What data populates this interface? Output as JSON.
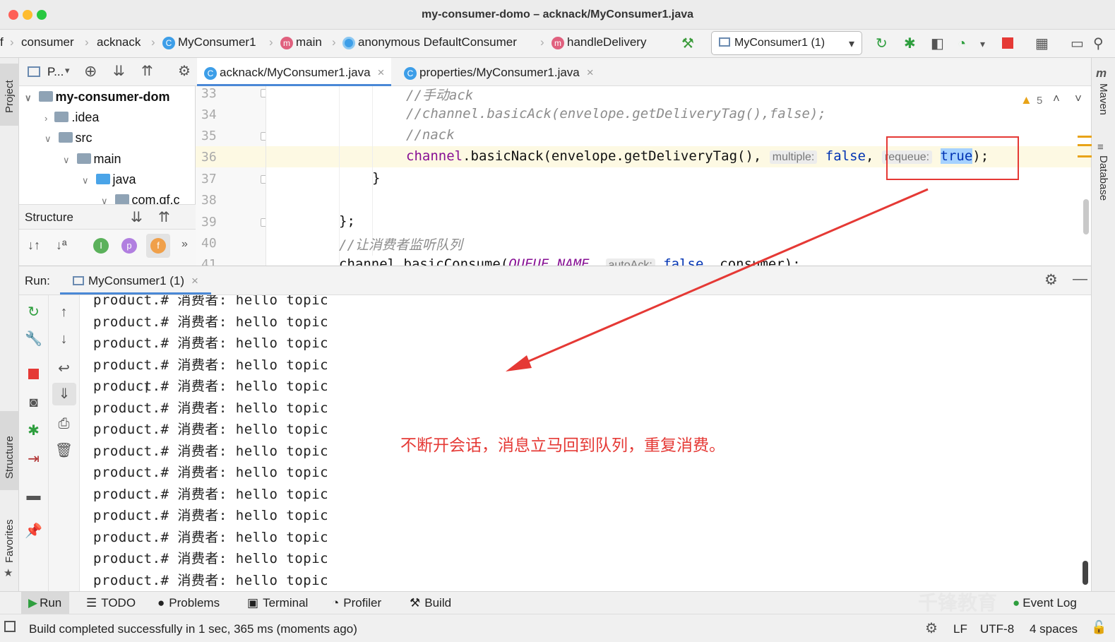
{
  "window": {
    "title": "my-consumer-domo – acknack/MyConsumer1.java"
  },
  "breadcrumb": {
    "lead": "f",
    "items": [
      "consumer",
      "acknack",
      "MyConsumer1",
      "main",
      "anonymous DefaultConsumer",
      "handleDelivery"
    ],
    "icons": [
      "",
      "",
      "C",
      "m",
      "",
      "m"
    ]
  },
  "toolbar": {
    "run_config": "MyConsumer1 (1)"
  },
  "project_panel": {
    "title": "P...",
    "tree": [
      {
        "label": "my-consumer-dom",
        "bold": true
      },
      {
        "label": ".idea"
      },
      {
        "label": "src"
      },
      {
        "label": "main"
      },
      {
        "label": "java"
      },
      {
        "label": "com.qf.c"
      }
    ]
  },
  "structure_panel": {
    "title": "Structure",
    "icon_letters": [
      "I",
      "p",
      "f"
    ],
    "more": "»"
  },
  "editor": {
    "tabs": [
      "acknack/MyConsumer1.java",
      "properties/MyConsumer1.java"
    ],
    "tab_icons": [
      "C",
      "C"
    ],
    "line_numbers": [
      "33",
      "34",
      "35",
      "36",
      "37",
      "38",
      "39",
      "40",
      "41"
    ],
    "lines": {
      "l33": "//手动ack",
      "l34": "//channel.basicAck(envelope.getDeliveryTag(),false);",
      "l35": "//nack",
      "l36_obj": "channel",
      "l36_call": ".basicNack(envelope.getDeliveryTag(), ",
      "l36_hint1": "multiple:",
      "l36_false": "false",
      "l36_comma": ", ",
      "l36_hint2": "requeue:",
      "l36_true": "true",
      "l36_end": ");",
      "l37": "}",
      "l39": "};",
      "l40": "//让消费者监听队列",
      "l41_a": "channel.basicConsume(",
      "l41_b": "QUEUE_NAME",
      "l41_c": ", ",
      "l41_hint": "autoAck:",
      "l41_false": "false",
      "l41_d": ", consumer);"
    },
    "warning_count": "5"
  },
  "run": {
    "label": "Run:",
    "tab": "MyConsumer1 (1)",
    "output": [
      "product.# 消费者: hello topic",
      "product.# 消费者: hello topic",
      "product.# 消费者: hello topic",
      "product.# 消费者: hello topic",
      "product.# 消费者: hello topic",
      "product.# 消费者: hello topic",
      "product.# 消费者: hello topic",
      "product.# 消费者: hello topic",
      "product.# 消费者: hello topic",
      "product.# 消费者: hello topic",
      "product.# 消费者: hello topic",
      "product.# 消费者: hello topic",
      "product.# 消费者: hello topic",
      "product.# 消费者: hello topic"
    ]
  },
  "annotation": {
    "text": "不断开会话，消息立马回到队列，重复消费。",
    "color": "#e53935"
  },
  "side_labels": {
    "project": "Project",
    "structure": "Structure",
    "favorites": "Favorites",
    "maven": "Maven",
    "database": "Database"
  },
  "bottom_tabs": [
    "Run",
    "TODO",
    "Problems",
    "Terminal",
    "Profiler",
    "Build"
  ],
  "event_log": "Event Log",
  "watermark": "千锋教育",
  "status": {
    "message": "Build completed successfully in 1 sec, 365 ms (moments ago)",
    "line_sep": "LF",
    "encoding": "UTF-8",
    "indent": "4 spaces"
  }
}
